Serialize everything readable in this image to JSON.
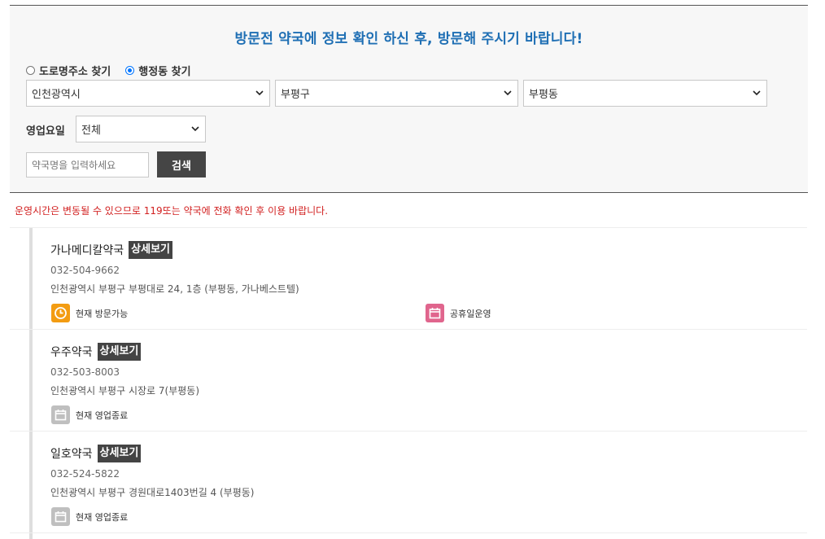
{
  "notice": {
    "title": "방문전 약국에 정보 확인 하신 후, 방문해 주시기 바랍니다!"
  },
  "search_mode": {
    "options": [
      {
        "label": "도로명주소 찾기",
        "checked": false
      },
      {
        "label": "행정동 찾기",
        "checked": true
      }
    ]
  },
  "filters": {
    "city": "인천광역시",
    "district": "부평구",
    "dong": "부평동",
    "day_label": "영업요일",
    "day_value": "전체"
  },
  "name_search": {
    "placeholder": "약국명을 입력하세요",
    "button_label": "검색"
  },
  "warning": "운영시간은 변동될 수 있으므로 119또는 약국에 전화 확인 후 이용 바랍니다.",
  "colors": {
    "title_blue": "#1f6fb4",
    "warning_red": "#d22121",
    "open_orange": "#f39c12",
    "holiday_pink": "#e0658d",
    "closed_gray": "#bfbfbf"
  },
  "pharmacies": [
    {
      "name": "가나메디칼약국",
      "detail_label": "상세보기",
      "phone": "032-504-9662",
      "address": "인천광역시 부평구 부평대로 24, 1층 (부평동, 가나베스트텔)",
      "statuses": [
        {
          "icon": "clock-icon",
          "label": "현재 방문가능"
        },
        {
          "icon": "calendar-icon",
          "label": "공휴일운영"
        }
      ]
    },
    {
      "name": "우주약국",
      "detail_label": "상세보기",
      "phone": "032-503-8003",
      "address": "인천광역시 부평구 시장로 7(부평동)",
      "statuses": [
        {
          "icon": "calendar-icon",
          "label": "현재 영업종료"
        }
      ]
    },
    {
      "name": "일호약국",
      "detail_label": "상세보기",
      "phone": "032-524-5822",
      "address": "인천광역시 부평구 경원대로1403번길 4 (부평동)",
      "statuses": [
        {
          "icon": "calendar-icon",
          "label": "현재 영업종료"
        }
      ]
    }
  ]
}
